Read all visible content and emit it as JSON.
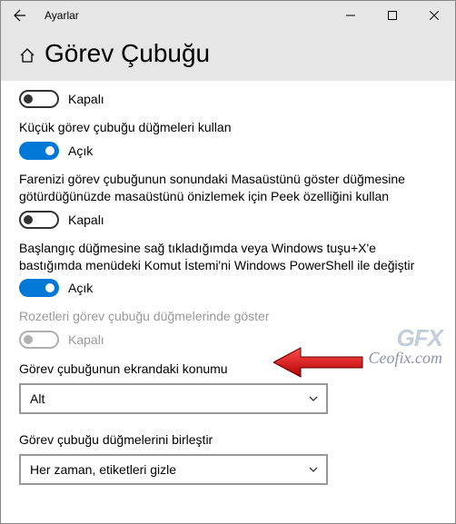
{
  "window": {
    "title": "Ayarlar"
  },
  "header": {
    "page_title": "Görev Çubuğu"
  },
  "settings": {
    "s1_state": "Kapalı",
    "s2_label": "Küçük görev çubuğu düğmeleri kullan",
    "s2_state": "Açık",
    "s3_label": "Farenizi görev çubuğunun sonundaki Masaüstünü göster düğmesine götürdüğünüzde masaüstünü önizlemek için Peek özelliğini kullan",
    "s3_state": "Kapalı",
    "s4_label": "Başlangıç düğmesine sağ tıkladığımda veya Windows tuşu+X'e bastığımda menüdeki Komut İstemi'ni Windows PowerShell ile değiştir",
    "s4_state": "Açık",
    "s5_label": "Rozetleri görev çubuğu düğmelerinde göster",
    "s5_state": "Kapalı",
    "dd1_label": "Görev çubuğunun ekrandaki konumu",
    "dd1_value": "Alt",
    "dd2_label": "Görev çubuğu düğmelerini birleştir",
    "dd2_value": "Her zaman, etiketleri gizle"
  },
  "watermark": {
    "logo": "GFX",
    "url": "Ceofix.com"
  }
}
